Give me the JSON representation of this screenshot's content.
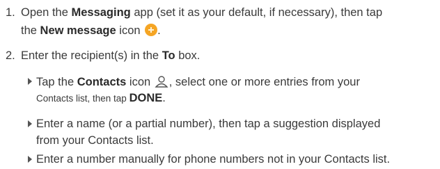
{
  "steps": [
    {
      "number": "1.",
      "line1": {
        "pre": "Open the ",
        "bold": "Messaging",
        "post": " app (set it as your default, if necessary), then tap"
      },
      "line2": {
        "pre": "the ",
        "bold": "New message",
        "post": " icon ",
        "end": "."
      },
      "icon": "plus-circle-icon"
    },
    {
      "number": "2.",
      "line1": {
        "pre": "Enter the recipient(s) in the ",
        "bold": "To",
        "post": " box."
      }
    }
  ],
  "bullets": [
    {
      "line1": {
        "pre": "Tap the ",
        "bold": "Contacts",
        "post": " icon ",
        "post2": ", select one or more entries from your"
      },
      "line2": {
        "pre": "Contacts list, then tap ",
        "bold": "DONE",
        "post": "."
      },
      "icon": "person-contacts-icon"
    },
    {
      "line1": "Enter a name (or a partial number), then tap a suggestion displayed",
      "line2": "from your Contacts list."
    },
    {
      "line1": "Enter a number manually for phone numbers not in your Contacts list."
    }
  ],
  "colors": {
    "text": "#3a3a3a",
    "icon_orange": "#f5a524",
    "bullet": "#555555"
  }
}
